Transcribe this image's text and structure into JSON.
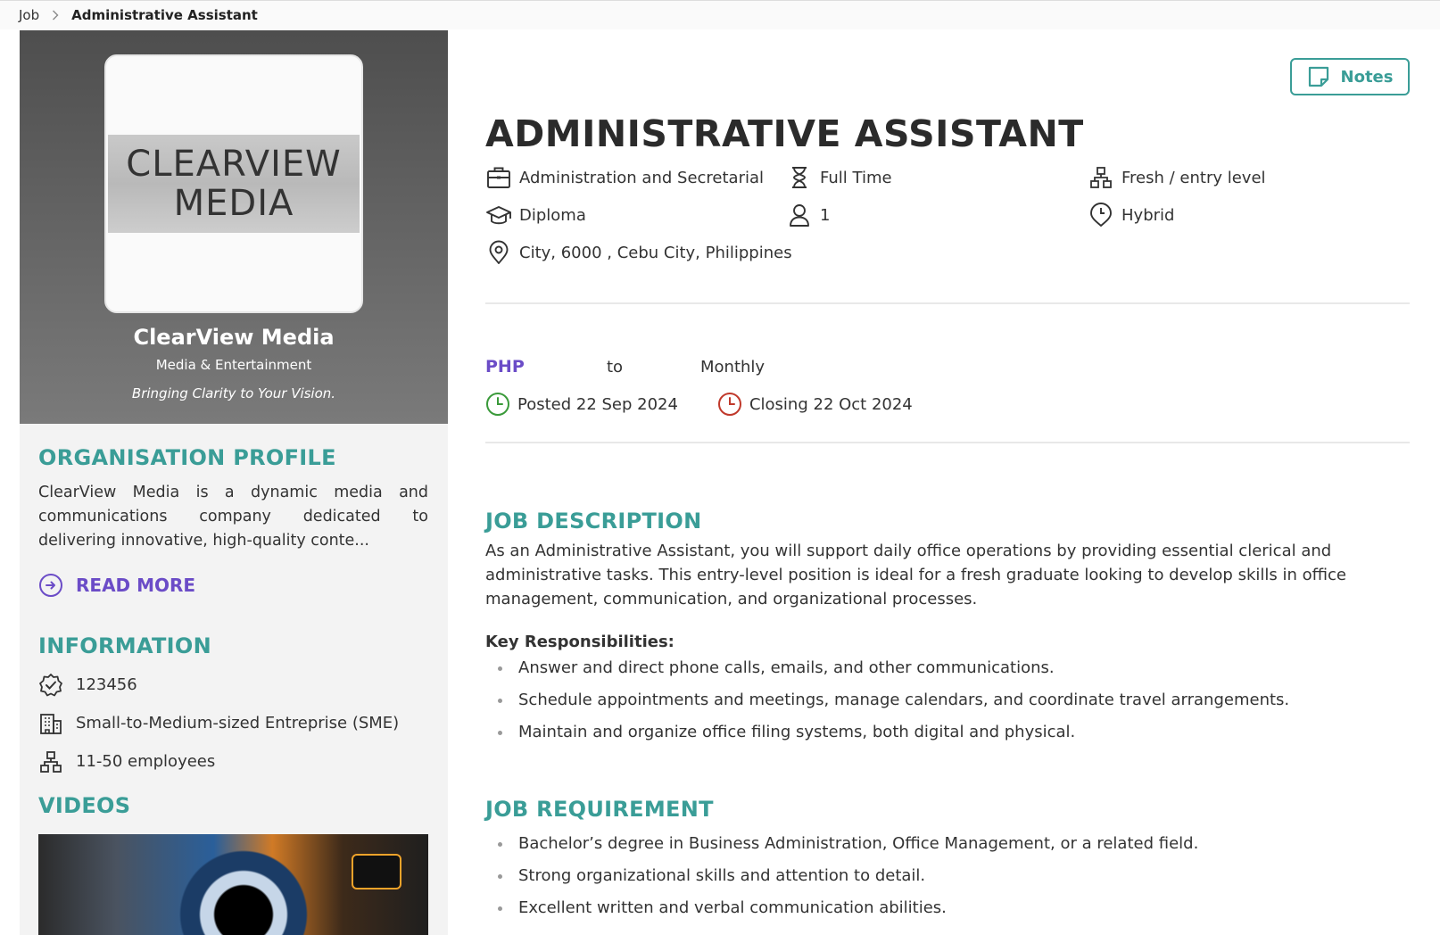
{
  "breadcrumb": {
    "parent": "Job",
    "current": "Administrative Assistant"
  },
  "company": {
    "logo_lines": [
      "CLEARVIEW",
      "MEDIA"
    ],
    "name": "ClearView Media",
    "industry": "Media & Entertainment",
    "tagline": "Bringing Clarity to Your Vision."
  },
  "profile": {
    "title": "ORGANISATION PROFILE",
    "text": "ClearView Media is a dynamic media and communications company dedicated to delivering innovative, high-quality conte...",
    "read_more": "READ MORE"
  },
  "information": {
    "title": "INFORMATION",
    "registration": "123456",
    "size": "Small-to-Medium-sized Entreprise (SME)",
    "employees": "11-50 employees"
  },
  "videos": {
    "title": "VIDEOS"
  },
  "notes_label": "Notes",
  "job": {
    "title": "ADMINISTRATIVE ASSISTANT",
    "category": "Administration and Secretarial",
    "employment_type": "Full Time",
    "level": "Fresh / entry level",
    "education": "Diploma",
    "vacancies": "1",
    "work_mode": "Hybrid",
    "location": "City, 6000 , Cebu City, Philippines",
    "currency": "PHP",
    "salary_to": "to",
    "salary_period": "Monthly",
    "posted": "Posted 22 Sep 2024",
    "closing": "Closing 22 Oct 2024"
  },
  "description": {
    "title": "JOB DESCRIPTION",
    "text": "As an Administrative Assistant, you will support daily office operations by providing essential clerical and administrative tasks. This entry-level position is ideal for a fresh graduate looking to develop skills in office management, communication, and organizational processes.",
    "key_title": "Key Responsibilities:",
    "responsibilities": [
      "Answer and direct phone calls, emails, and other communications.",
      "Schedule appointments and meetings, manage calendars, and coordinate travel arrangements.",
      "Maintain and organize office filing systems, both digital and physical."
    ]
  },
  "requirement": {
    "title": "JOB REQUIREMENT",
    "items": [
      "Bachelor’s degree in Business Administration, Office Management, or a related field.",
      "Strong organizational skills and attention to detail.",
      "Excellent written and verbal communication abilities."
    ]
  },
  "colors": {
    "accent_teal": "#3a9d97",
    "accent_purple": "#6b4cc7",
    "posted_green": "#3a9a3a",
    "closing_red": "#c0392b"
  }
}
